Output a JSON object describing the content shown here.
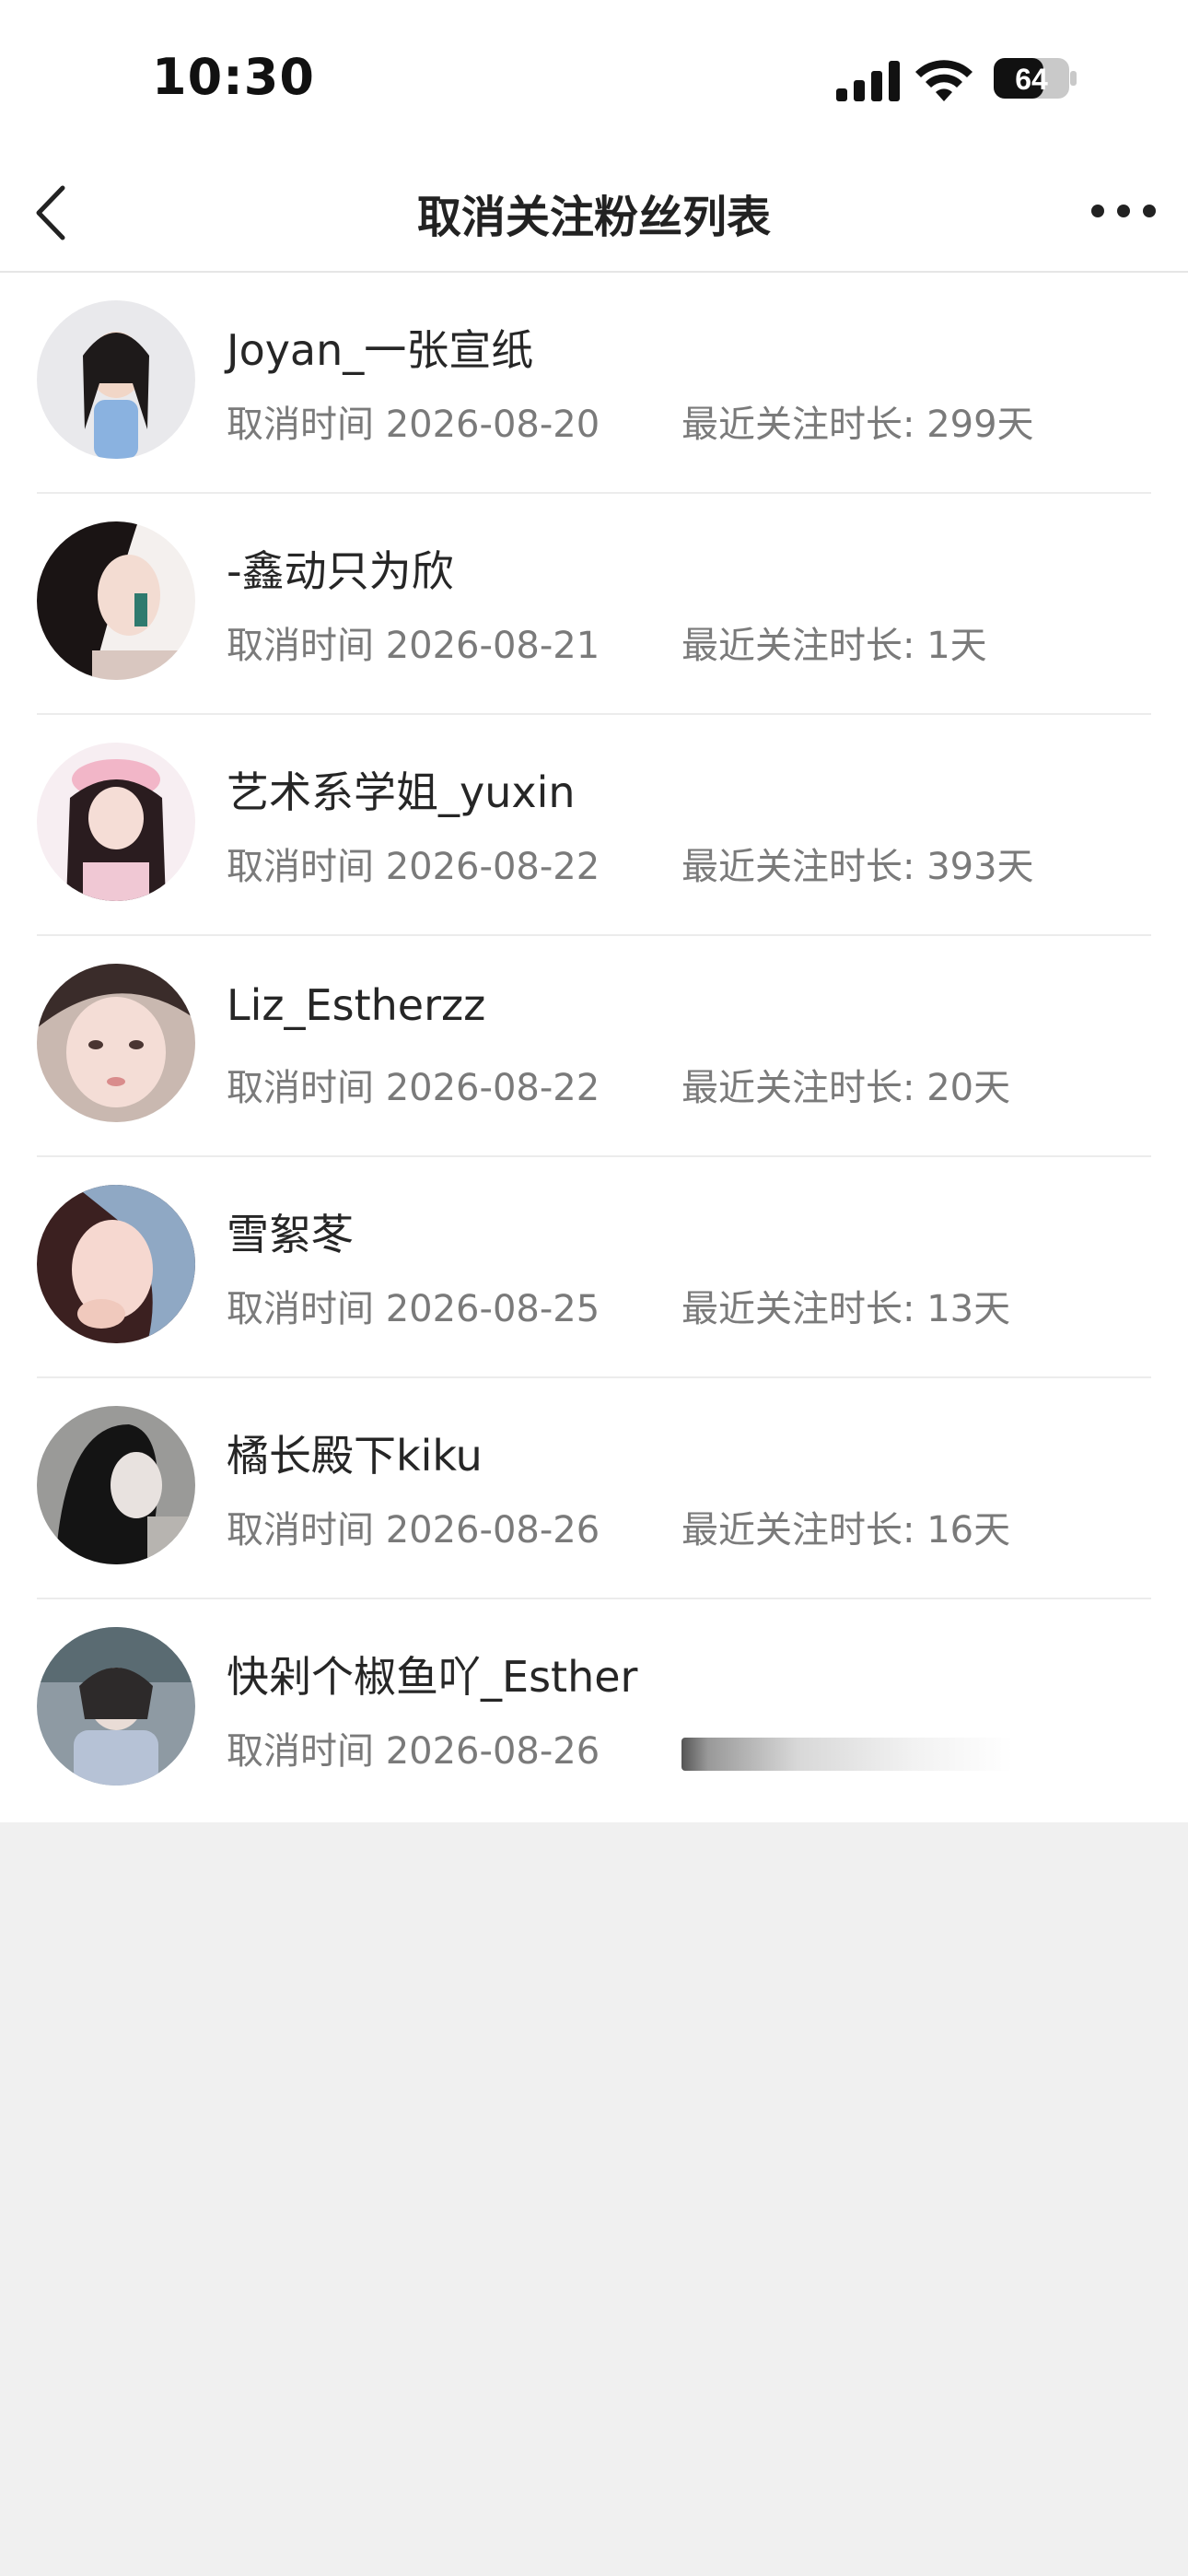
{
  "status_bar": {
    "time": "10:30",
    "battery_level": "64",
    "icons": [
      "signal-icon",
      "wifi-icon",
      "battery-icon"
    ]
  },
  "nav": {
    "title": "取消关注粉丝列表",
    "back_icon": "chevron-left-icon",
    "more_icon": "more-dots-icon"
  },
  "list": {
    "items": [
      {
        "name": "Joyan_一张宣纸",
        "cancel_time": "取消时间 2026-08-20",
        "duration": "最近关注时长: 299天"
      },
      {
        "name": "-鑫动只为欣",
        "cancel_time": "取消时间 2026-08-21",
        "duration": "最近关注时长: 1天"
      },
      {
        "name": "艺术系学姐_yuxin",
        "cancel_time": "取消时间 2026-08-22",
        "duration": "最近关注时长: 393天"
      },
      {
        "name": "Liz_Estherzz",
        "cancel_time": "取消时间 2026-08-22",
        "duration": "最近关注时长: 20天"
      },
      {
        "name": "雪絮苳",
        "cancel_time": "取消时间 2026-08-25",
        "duration": "最近关注时长: 13天"
      },
      {
        "name": "橘长殿下kiku",
        "cancel_time": "取消时间 2026-08-26",
        "duration": "最近关注时长: 16天"
      },
      {
        "name": "快剁个椒鱼吖_Esther",
        "cancel_time": "取消时间 2026-08-26",
        "duration": ""
      }
    ]
  },
  "colors": {
    "background": "#f0f0f0",
    "surface": "#ffffff",
    "primary_text": "#262626",
    "secondary_text": "#7a7a7a",
    "divider": "#ececec"
  }
}
